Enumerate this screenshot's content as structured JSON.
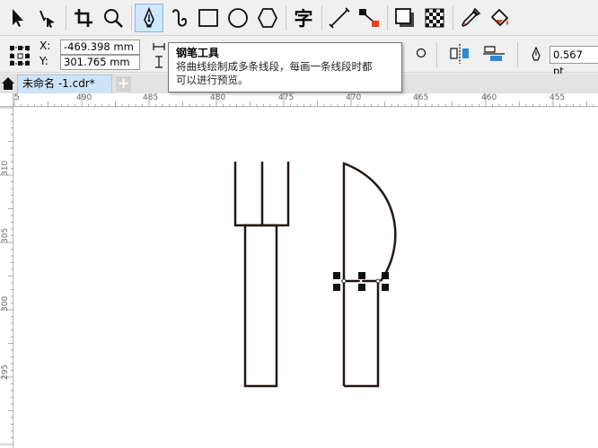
{
  "toolbar": {
    "tools": [
      {
        "name": "pick-tool",
        "icon": "arrow-pointer-icon"
      },
      {
        "name": "shape-tool",
        "icon": "node-edit-icon"
      },
      {
        "name": "crop-tool",
        "icon": "crop-icon"
      },
      {
        "name": "zoom-tool",
        "icon": "magnifier-icon"
      },
      {
        "name": "pen-tool",
        "icon": "pen-nib-icon",
        "active": true
      },
      {
        "name": "bspline-tool",
        "icon": "spiral-curve-icon"
      },
      {
        "name": "rectangle-tool",
        "icon": "rectangle-icon"
      },
      {
        "name": "ellipse-tool",
        "icon": "ellipse-icon"
      },
      {
        "name": "polygon-tool",
        "icon": "hexagon-icon"
      },
      {
        "name": "text-tool",
        "icon": "text-char-icon",
        "glyph": "字"
      },
      {
        "name": "dimension-tool",
        "icon": "diagonal-line-icon"
      },
      {
        "name": "connector-tool",
        "icon": "connector-icon"
      },
      {
        "name": "drop-shadow-tool",
        "icon": "shadow-icon"
      },
      {
        "name": "transparency-tool",
        "icon": "checkerboard-icon"
      },
      {
        "name": "eyedropper-tool",
        "icon": "eyedropper-icon"
      },
      {
        "name": "fill-tool",
        "icon": "paint-bucket-icon"
      }
    ]
  },
  "propbar": {
    "x_label": "X:",
    "x_value": "-469.398 mm",
    "y_label": "Y:",
    "y_value": "301.765 mm",
    "outline_width": "0.567 pt"
  },
  "tooltip": {
    "title": "钢笔工具",
    "description_line1": "将曲线绘制成多条线段，每画一条线段时都",
    "description_line2": "可以进行预览。"
  },
  "tabs": {
    "document": "未命名 -1.cdr*",
    "add": "+"
  },
  "ruler": {
    "h_labels": [
      "5",
      "490",
      "485",
      "480",
      "475",
      "470",
      "465",
      "460",
      "455"
    ],
    "v_labels": [
      "310",
      "305",
      "300",
      "295"
    ]
  },
  "colors": {
    "accent": "#cfe6fb",
    "stroke": "#231815"
  }
}
